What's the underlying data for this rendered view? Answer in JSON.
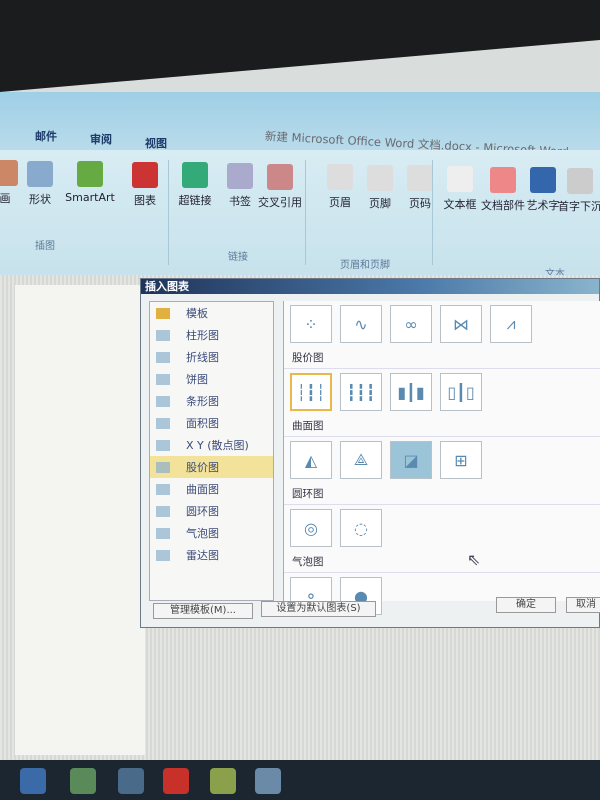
{
  "window": {
    "title": "新建 Microsoft Office Word 文档.docx - Microsoft Word"
  },
  "tabs": [
    "邮件",
    "审阅",
    "视图"
  ],
  "ribbon": {
    "buttons": [
      {
        "label": "画",
        "icon": "picture-icon"
      },
      {
        "label": "形状",
        "icon": "shapes-icon"
      },
      {
        "label": "SmartArt",
        "icon": "smartart-icon"
      },
      {
        "label": "图表",
        "icon": "chart-icon"
      },
      {
        "label": "超链接",
        "icon": "hyperlink-icon"
      },
      {
        "label": "书签",
        "icon": "bookmark-icon"
      },
      {
        "label": "交叉引用",
        "icon": "cross-reference-icon"
      },
      {
        "label": "页眉",
        "icon": "header-icon"
      },
      {
        "label": "页脚",
        "icon": "footer-icon"
      },
      {
        "label": "页码",
        "icon": "page-number-icon"
      },
      {
        "label": "文本框",
        "icon": "textbox-icon"
      },
      {
        "label": "文档部件",
        "icon": "quick-parts-icon"
      },
      {
        "label": "艺术字",
        "icon": "wordart-icon"
      },
      {
        "label": "首字下沉",
        "icon": "drop-cap-icon"
      }
    ],
    "groups": [
      "插图",
      "链接",
      "页眉和页脚",
      "文本"
    ]
  },
  "dialog": {
    "title": "插入图表",
    "categories": [
      "模板",
      "柱形图",
      "折线图",
      "饼图",
      "条形图",
      "面积图",
      "X Y (散点图)",
      "股价图",
      "曲面图",
      "圆环图",
      "气泡图",
      "雷达图"
    ],
    "selected_category": "股价图",
    "sections": [
      "股价图",
      "曲面图",
      "圆环图",
      "气泡图"
    ],
    "manage_templates": "管理模板(M)...",
    "set_default": "设置为默认图表(S)",
    "ok": "确定",
    "cancel": "取消"
  }
}
